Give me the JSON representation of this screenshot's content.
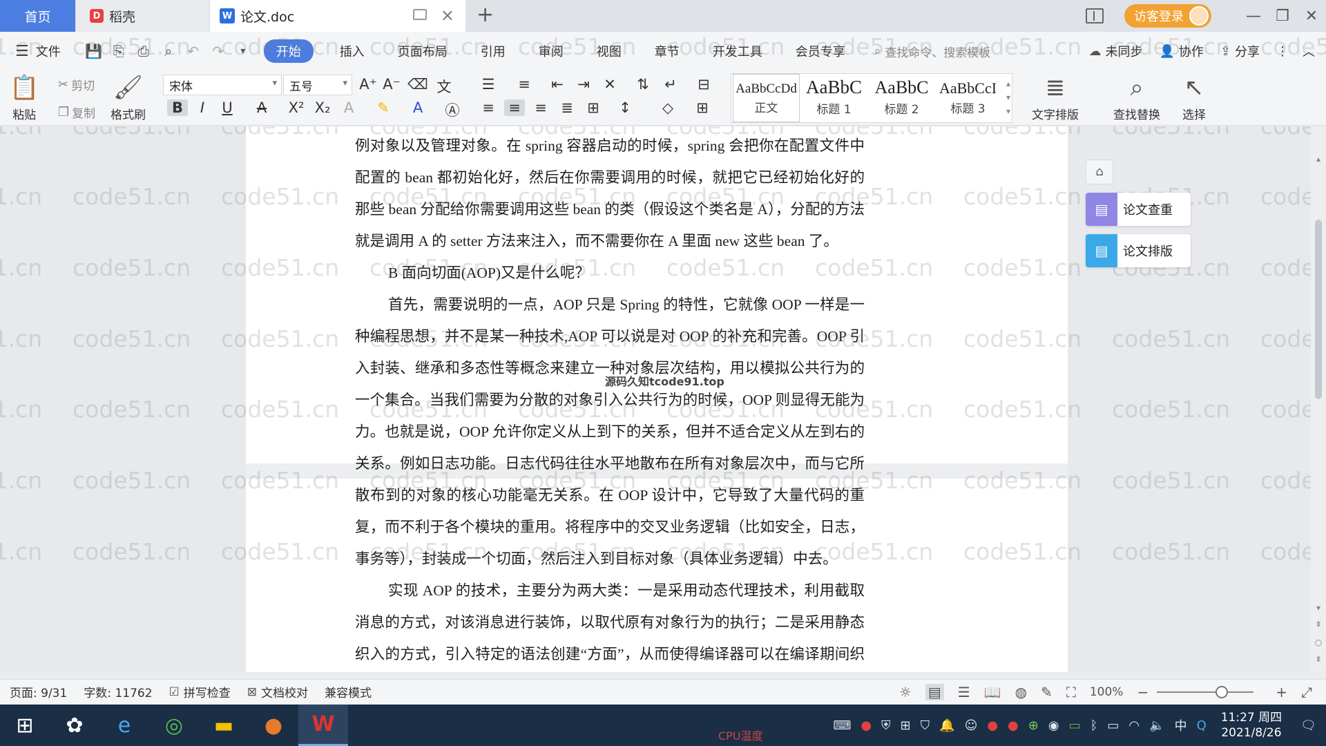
{
  "titlebar": {
    "tabs": [
      {
        "label": "首页"
      },
      {
        "label": "稻壳"
      },
      {
        "label": "论文.doc"
      }
    ],
    "visitor_login": "访客登录"
  },
  "ribbon_tabs": {
    "file": "文件",
    "items": [
      "开始",
      "插入",
      "页面布局",
      "引用",
      "审阅",
      "视图",
      "章节",
      "开发工具",
      "会员专享"
    ],
    "active": "开始",
    "search_placeholder": "查找命令、搜索模板",
    "sync": "未同步",
    "collab": "协作",
    "share": "分享"
  },
  "ribbon": {
    "paste": "粘贴",
    "cut": "剪切",
    "copy": "复制",
    "format_painter": "格式刷",
    "font_name": "宋体",
    "font_size": "五号",
    "styles": [
      {
        "preview": "AaBbCcDd",
        "name": "正文"
      },
      {
        "preview": "AaBbC",
        "name": "标题 1"
      },
      {
        "preview": "AaBbC",
        "name": "标题 2"
      },
      {
        "preview": "AaBbCcI",
        "name": "标题 3"
      }
    ],
    "text_layout": "文字排版",
    "find_replace": "查找替换",
    "select": "选择"
  },
  "document": {
    "paragraphs": [
      {
        "indent": false,
        "text": "例对象以及管理对象。在 spring 容器启动的时候，spring 会把你在配置文件中配置的 bean 都初始化好，然后在你需要调用的时候，就把它已经初始化好的那些 bean 分配给你需要调用这些 bean 的类（假设这个类名是 A），分配的方法就是调用 A 的 setter 方法来注入，而不需要你在 A 里面 new 这些 bean 了。"
      },
      {
        "indent": true,
        "text": "B 面向切面(AOP)又是什么呢？"
      },
      {
        "indent": true,
        "text": "首先，需要说明的一点，AOP 只是 Spring 的特性，它就像 OOP 一样是一种编程思想，并不是某一种技术,AOP 可以说是对 OOP 的补充和完善。OOP 引入封装、继承和多态性等概念来建立一种对象层次结构，用以模拟公共行为的一个集合。当我们需要为分散的对象引入公共行为的时候，OOP 则显得无能为力。也就是说，OOP 允许你定义从上到下的关系，但并不适合定义从左到右的关系。例如日志功能。日志代码往往水平地散布在所有对象层次中，而与它所散布到的对象的核心功能毫无关系。在 OOP 设计中，它导致了大量代码的重复，而不利于各个模块的重用。将程序中的交叉业务逻辑（比如安全，日志，事务等），封装成一个切面，然后注入到目标对象（具体业务逻辑）中去。"
      },
      {
        "indent": true,
        "text": "实现 AOP 的技术，主要分为两大类：一是采用动态代理技术，利用截取消息的方式，对该消息进行装饰，以取代原有对象行为的执行；二是采用静态织入的方式，引入特定的语法创建“方面”，从而使得编译器可以在编译期间织入有关“方面”的代码。"
      }
    ],
    "overlay_text": "源码久知tcode91.top",
    "watermark": "code51.cn"
  },
  "side_tools": {
    "check": "论文查重",
    "layout": "论文排版"
  },
  "statusbar": {
    "page": "页面: 9/31",
    "words": "字数: 11762",
    "spell": "拼写检查",
    "proof": "文档校对",
    "compat": "兼容模式",
    "zoom": "100%",
    "zoom_fraction": 0.67
  },
  "taskbar": {
    "time": "11:27 周四",
    "date": "2021/8/26",
    "ime": "中",
    "cpu": "CPU温度"
  },
  "colors": {
    "accent": "#4c7de0",
    "visitor": "#f2a233",
    "taskbar": "#1a2e46",
    "side_check": "#8f86e6",
    "side_layout": "#3ba8e8"
  }
}
